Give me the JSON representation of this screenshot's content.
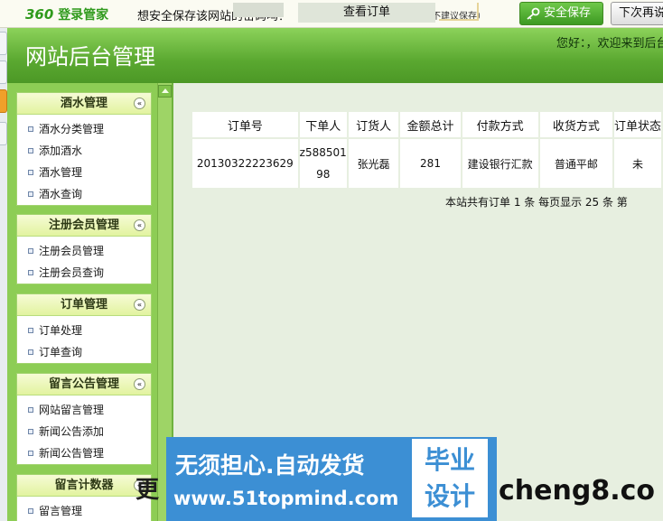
{
  "password_bar": {
    "brand_num": "360",
    "brand_text": "登录管家",
    "question": "想安全保存该网站的密码吗？",
    "hint": "（若您使用网吧等公共电脑不建议保存）",
    "save_label": "安全保存",
    "later_label": "下次再说"
  },
  "header": {
    "title": "网站后台管理",
    "welcome": "您好：，欢迎来到后台"
  },
  "sidebar": {
    "groups": [
      {
        "title": "酒水管理",
        "items": [
          "酒水分类管理",
          "添加酒水",
          "酒水管理",
          "酒水查询"
        ]
      },
      {
        "title": "注册会员管理",
        "items": [
          "注册会员管理",
          "注册会员查询"
        ]
      },
      {
        "title": "订单管理",
        "items": [
          "订单处理",
          "订单查询"
        ]
      },
      {
        "title": "留言公告管理",
        "items": [
          "网站留言管理",
          "新闻公告添加",
          "新闻公告管理"
        ]
      },
      {
        "title": "留言计数器",
        "items": [
          "留言管理"
        ]
      }
    ],
    "toggle_glyph": "«"
  },
  "main": {
    "panel_title": "查看订单",
    "table": {
      "headers": [
        "订单号",
        "下单人",
        "订货人",
        "金额总计",
        "付款方式",
        "收货方式",
        "订单状态"
      ],
      "rows": [
        {
          "order_no": "20130322223629",
          "placer_1": "z588501",
          "placer_2": "98",
          "buyer": "张光磊",
          "amount": "281",
          "payment": "建设银行汇款",
          "shipping": "普通平邮",
          "status": "未"
        }
      ]
    },
    "summary": "本站共有订单 1  条 每页显示 25 条 第"
  },
  "ad": {
    "slogan": "无须担心.自动发货",
    "url": "www.51topmind.com",
    "badge_line1": "毕业",
    "badge_line2": "设计",
    "left_char": "更",
    "right_text": "cheng8.co"
  },
  "colors": {
    "header_green": "#5aa830",
    "sidebar_green": "#8dcd55",
    "ad_blue": "#3c8fd4"
  }
}
